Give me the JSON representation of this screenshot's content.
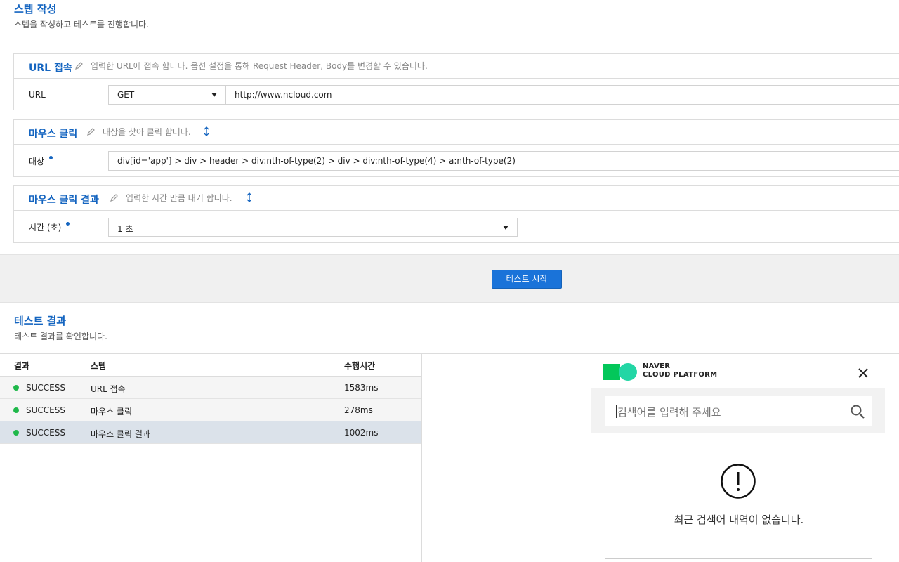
{
  "header": {
    "title": "스텝 작성",
    "subtitle": "스텝을 작성하고 테스트를 진행합니다."
  },
  "steps": [
    {
      "title": "URL 접속",
      "description": "입력한 URL에 접속 합니다. 옵션 설정을 통해 Request Header, Body를 변경할 수 있습니다.",
      "field_label": "URL",
      "method": "GET",
      "url": "http://www.ncloud.com"
    },
    {
      "title": "마우스 클릭",
      "description": "대상을 찾아 클릭 합니다.",
      "field_label": "대상",
      "target": "div[id='app'] > div > header > div:nth-of-type(2) > div > div:nth-of-type(4) > a:nth-of-type(2)"
    },
    {
      "title": "마우스 클릭 결과",
      "description": "입력한 시간 만큼 대기 합니다.",
      "field_label": "시간 (초)",
      "time_value": "1 초"
    }
  ],
  "actions": {
    "start_label": "테스트 시작",
    "start_color": "#1a73d9"
  },
  "results": {
    "title": "테스트 결과",
    "subtitle": "테스트 결과를 확인합니다.",
    "columns": [
      "결과",
      "스텝",
      "수행시간"
    ],
    "rows": [
      {
        "status": "SUCCESS",
        "step": "URL 접속",
        "duration": "1583ms"
      },
      {
        "status": "SUCCESS",
        "step": "마우스 클릭",
        "duration": "278ms"
      },
      {
        "status": "SUCCESS",
        "step": "마우스 클릭 결과",
        "duration": "1002ms"
      }
    ],
    "status_color": "#1fb84a"
  },
  "search_popup": {
    "brand_line1": "NAVER",
    "brand_line2": "CLOUD PLATFORM",
    "placeholder": "검색어를 입력해 주세요",
    "empty_message": "최근 검색어 내역이 없습니다.",
    "icons": [
      "naver-cloud-logo-icon",
      "close-icon",
      "search-icon",
      "alert-circle-icon"
    ]
  }
}
